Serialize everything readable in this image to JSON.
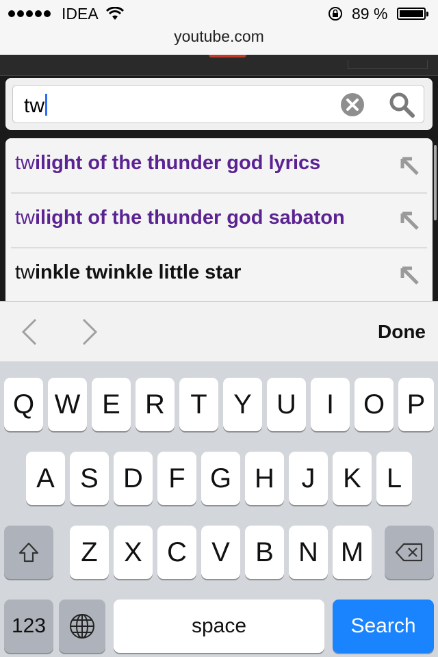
{
  "status_bar": {
    "carrier": "IDEA",
    "battery_percent": "89 %",
    "url": "youtube.com"
  },
  "search": {
    "query": "tw"
  },
  "suggestions": [
    {
      "typed": "tw",
      "rest": "ilight of the thunder god lyrics",
      "visited": true
    },
    {
      "typed": "tw",
      "rest": "ilight of the thunder god sabaton",
      "visited": true
    },
    {
      "typed": "tw",
      "rest": "inkle twinkle little star",
      "visited": false
    }
  ],
  "accessory": {
    "done_label": "Done"
  },
  "keyboard": {
    "row1": [
      "Q",
      "W",
      "E",
      "R",
      "T",
      "Y",
      "U",
      "I",
      "O",
      "P"
    ],
    "row2": [
      "A",
      "S",
      "D",
      "F",
      "G",
      "H",
      "J",
      "K",
      "L"
    ],
    "row3": [
      "Z",
      "X",
      "C",
      "V",
      "B",
      "N",
      "M"
    ],
    "numbers_label": "123",
    "space_label": "space",
    "search_label": "Search"
  },
  "colors": {
    "visited": "#5b2392",
    "search_key": "#1a84ff",
    "caret": "#2f6df6"
  },
  "icons": [
    "wifi-icon",
    "rotation-lock-icon",
    "battery-icon",
    "clear-icon",
    "search-icon",
    "arrow-up-left-icon",
    "chevron-left-icon",
    "chevron-right-icon",
    "shift-icon",
    "backspace-icon",
    "globe-icon"
  ]
}
